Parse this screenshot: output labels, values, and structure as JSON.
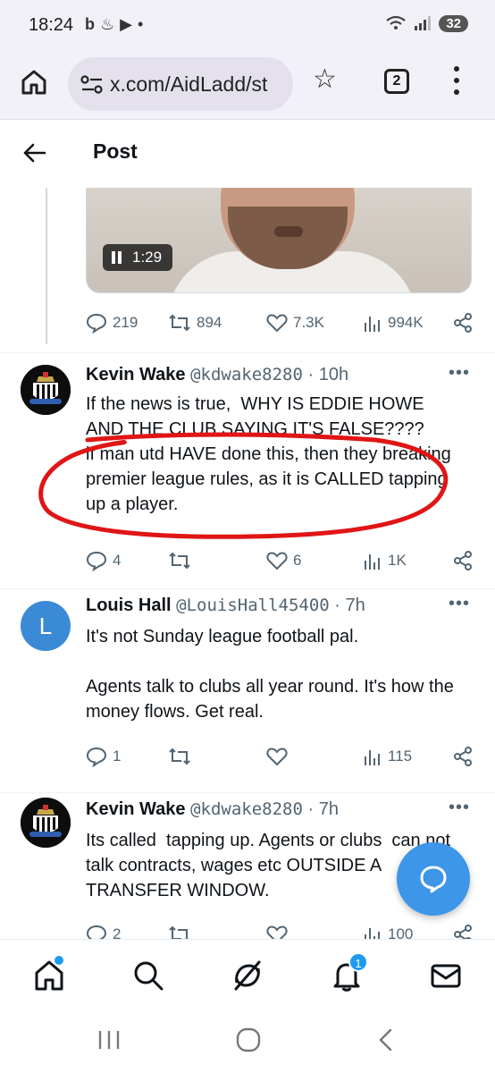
{
  "status_bar": {
    "time": "18:24",
    "battery": "32"
  },
  "browser": {
    "url": "x.com/AidLadd/st",
    "tab_count": "2"
  },
  "header": {
    "title": "Post"
  },
  "video": {
    "duration": "1:29"
  },
  "main_post_stats": {
    "replies": "219",
    "reposts": "894",
    "likes": "7.3K",
    "views": "994K"
  },
  "replies": [
    {
      "name": "Kevin Wake",
      "handle": "@kdwake8280",
      "time": "· 10h",
      "text": "If the news is true,  WHY IS EDDIE HOWE AND THE CLUB SAYING IT'S FALSE????\nif man utd HAVE done this, then they breaking premier league rules, as it is CALLED tapping up a player.",
      "replies": "4",
      "reposts": "",
      "likes": "6",
      "views": "1K"
    },
    {
      "name": "Louis Hall",
      "handle": "@LouisHall45400",
      "time": "· 7h",
      "avatar_letter": "L",
      "text": "It's not Sunday league football pal.\n\nAgents talk to clubs all year round. It's how the money flows. Get real.",
      "replies": "1",
      "reposts": "",
      "likes": "",
      "views": "115"
    },
    {
      "name": "Kevin Wake",
      "handle": "@kdwake8280",
      "time": "· 7h",
      "text": "Its called  tapping up. Agents or clubs  can not talk contracts, wages etc OUTSIDE A TRANSFER WINDOW.",
      "replies": "2",
      "reposts": "",
      "likes": "",
      "views": "100"
    }
  ],
  "bottom_nav": {
    "notifications_count": "1"
  },
  "colors": {
    "accent": "#1d9bf0",
    "annotation": "#e01515"
  }
}
